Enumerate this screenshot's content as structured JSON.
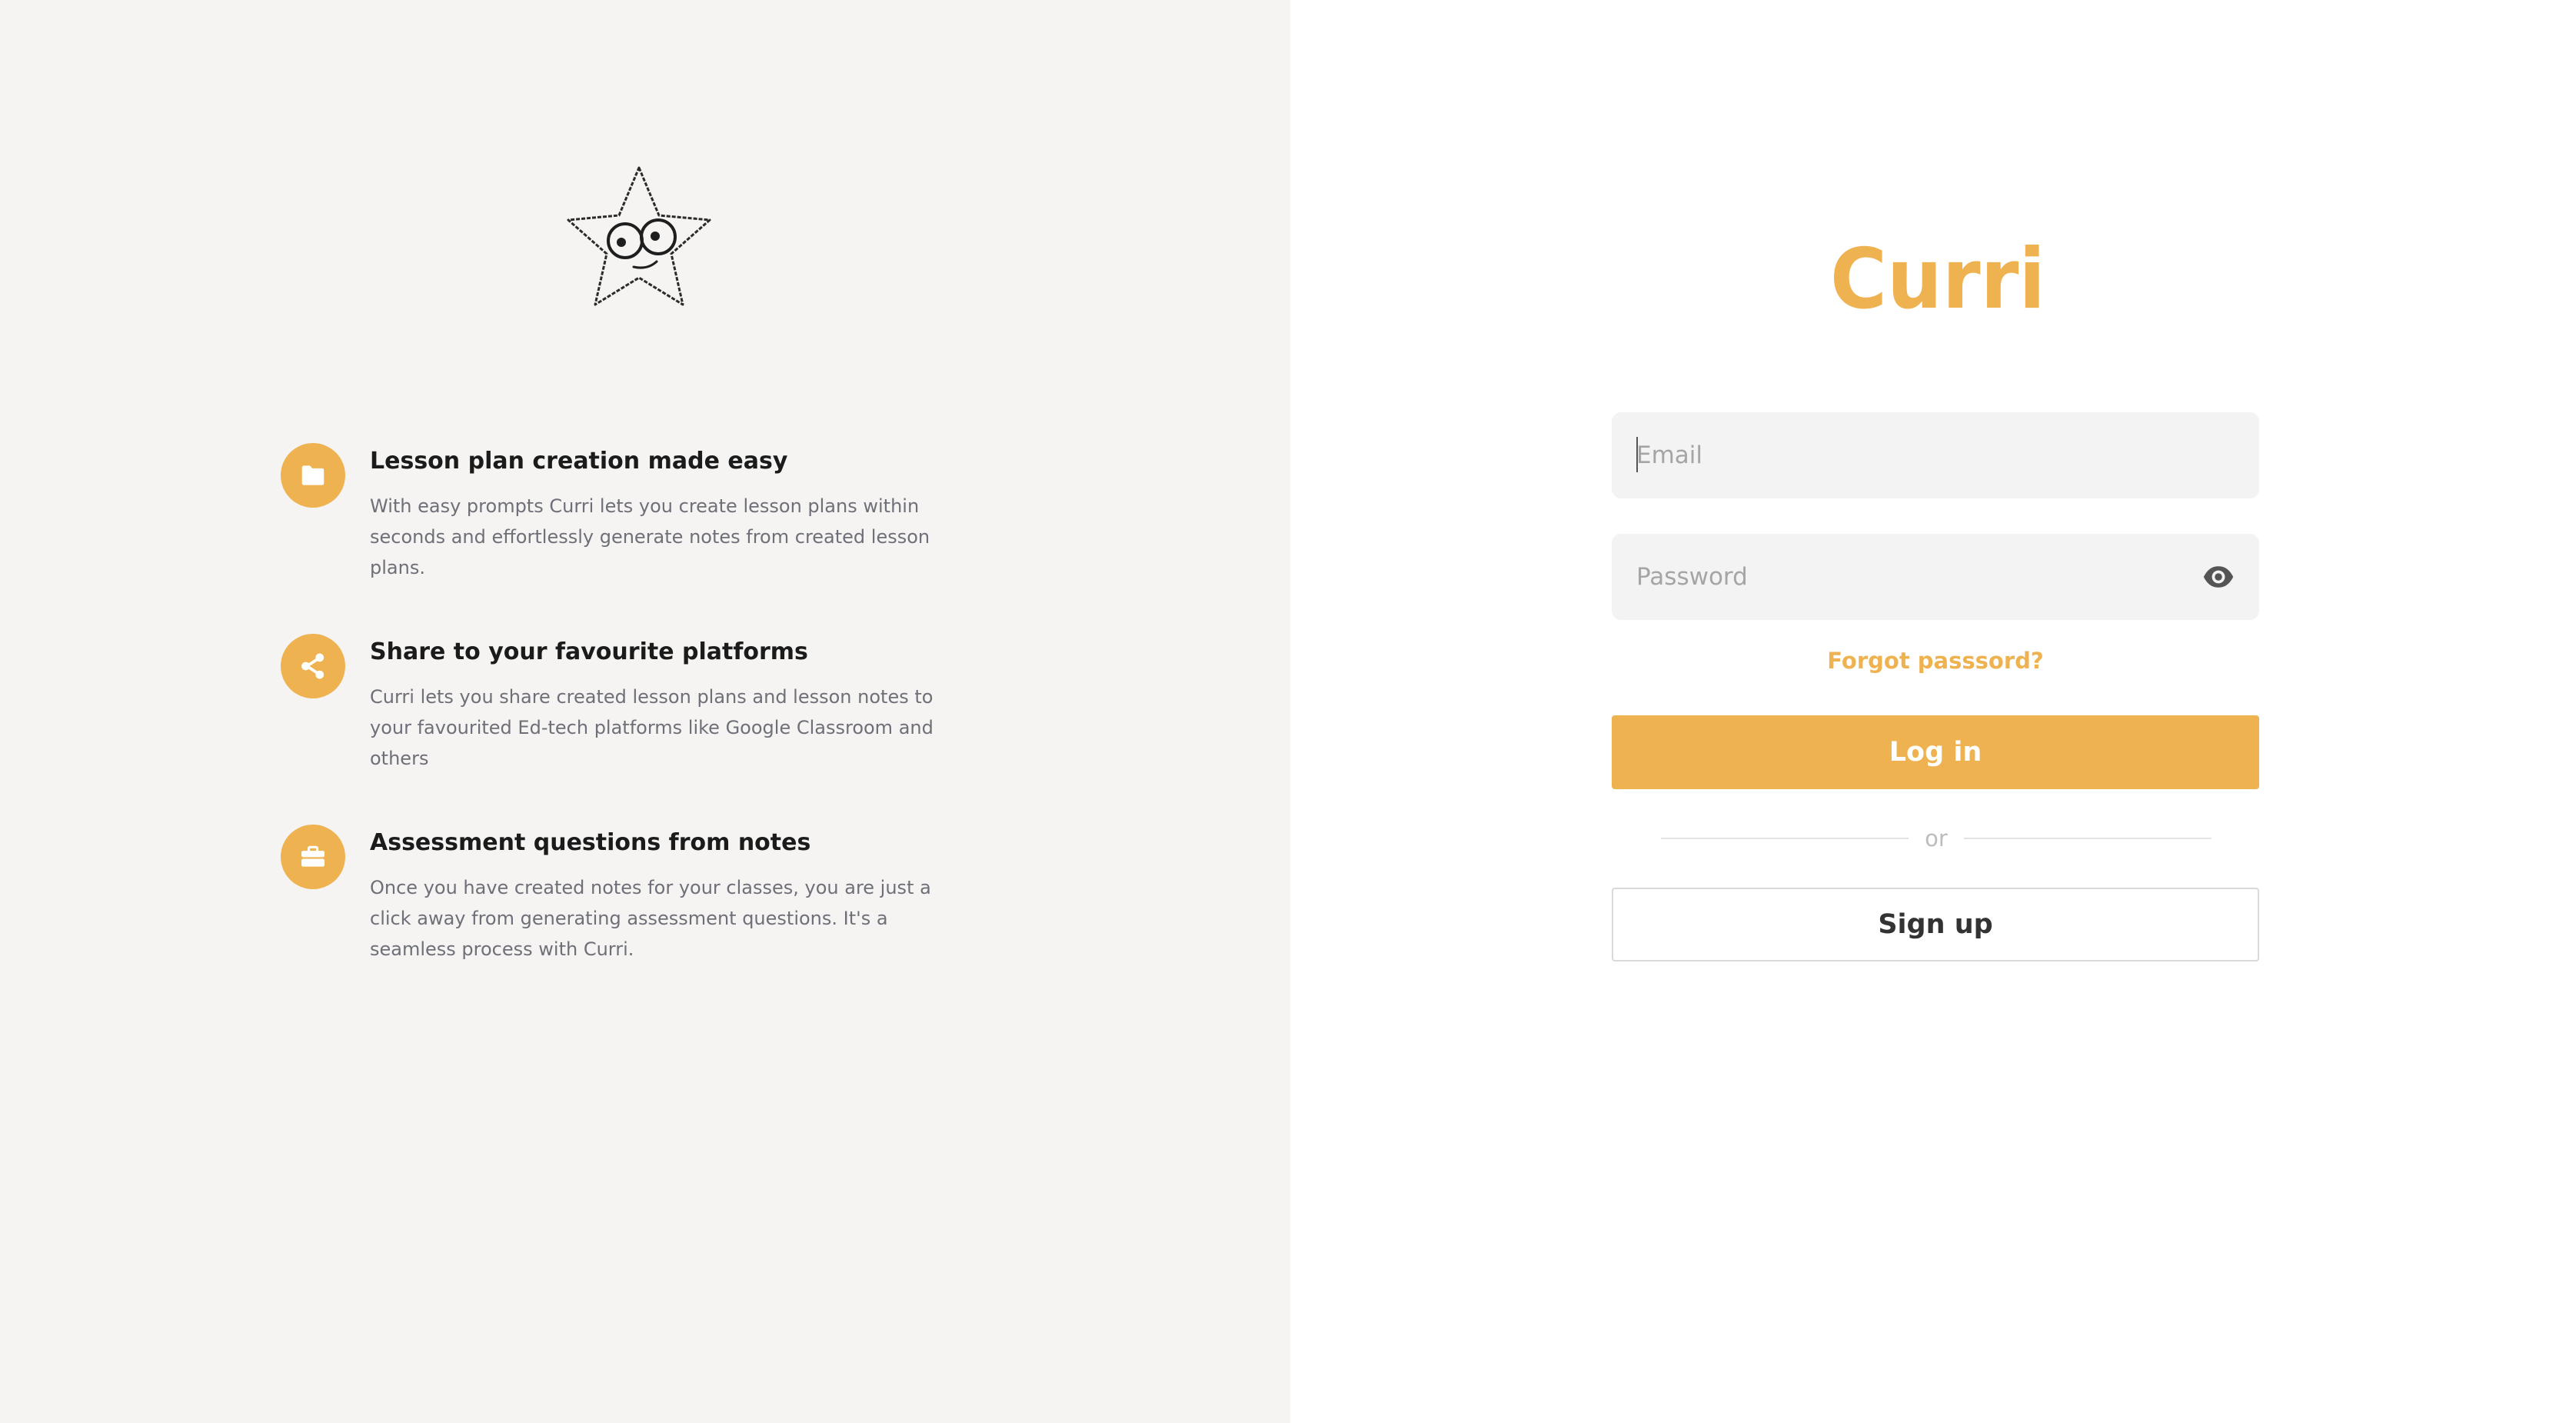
{
  "brand": {
    "name": "Curri",
    "accent_color": "#EFB250"
  },
  "features": [
    {
      "icon": "folder-icon",
      "title": "Lesson plan creation made easy",
      "description": "With easy prompts Curri lets you create lesson plans within seconds and effortlessly generate notes from created lesson plans."
    },
    {
      "icon": "share-icon",
      "title": "Share to your favourite platforms",
      "description": "Curri lets you share created lesson plans and lesson notes to your favourited Ed-tech platforms like Google Classroom and others"
    },
    {
      "icon": "briefcase-icon",
      "title": "Assessment questions from notes",
      "description": "Once you have created notes for your classes, you are just a click away from generating assessment questions. It's a seamless process with Curri."
    }
  ],
  "login_form": {
    "email_placeholder": "Email",
    "password_placeholder": "Password",
    "forgot_password": "Forgot passsord?",
    "login_label": "Log in",
    "divider_text": "or",
    "signup_label": "Sign up"
  }
}
